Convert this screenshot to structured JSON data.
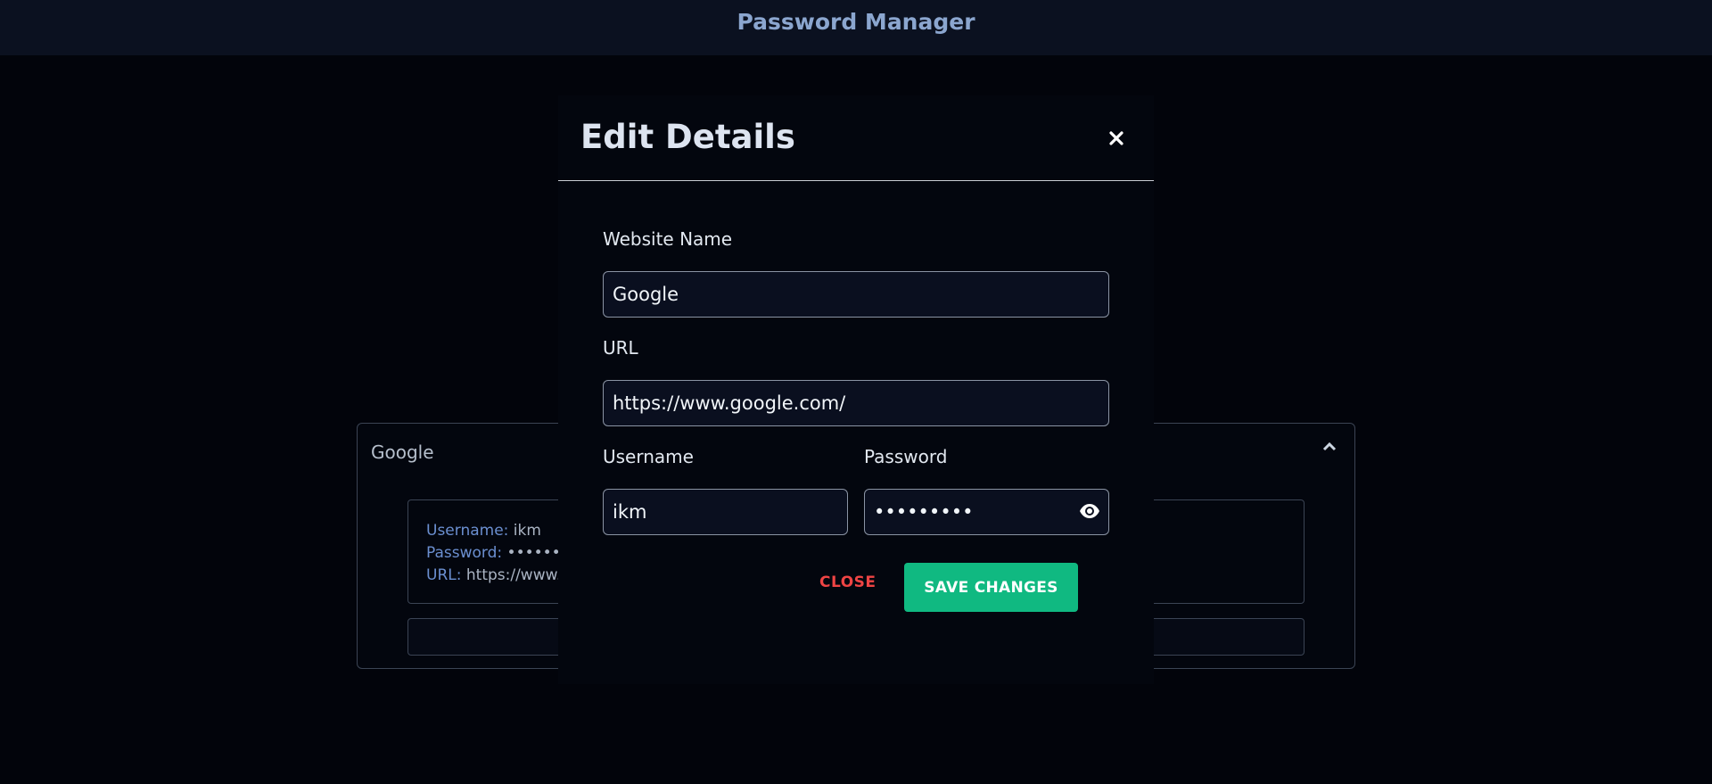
{
  "app": {
    "title": "Password Manager"
  },
  "card": {
    "title": "Google",
    "details": {
      "username_label": "Username:",
      "username_value": "ikm",
      "password_label": "Password:",
      "password_value": "•••••••••",
      "url_label": "URL:",
      "url_value": "https://www.g"
    }
  },
  "modal": {
    "title": "Edit Details",
    "website_name": {
      "label": "Website Name",
      "value": "Google"
    },
    "url": {
      "label": "URL",
      "value": "https://www.google.com/"
    },
    "username": {
      "label": "Username",
      "value": "ikm"
    },
    "password": {
      "label": "Password",
      "value": "•••••••••"
    },
    "close_label": "CLOSE",
    "save_label": "SAVE CHANGES"
  },
  "icons": {
    "modal_close": "close-icon",
    "password_toggle": "eye-icon",
    "card_toggle": "chevron-up-icon"
  },
  "colors": {
    "accent": "#10b981",
    "danger": "#ef4444",
    "background": "#02040b",
    "header_text": "#8ba6cf"
  }
}
